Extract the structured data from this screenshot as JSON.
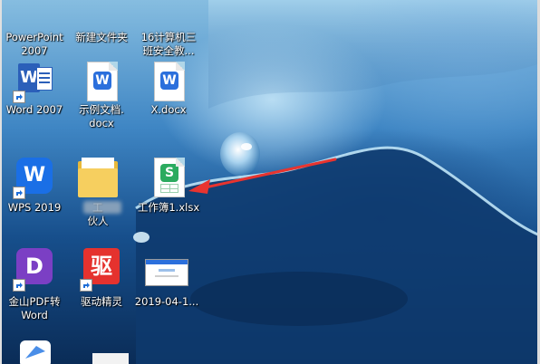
{
  "desktop": {
    "icons": [
      {
        "id": "powerpoint-2007",
        "label_lines": [
          "PowerPoint",
          "2007"
        ]
      },
      {
        "id": "new-folder",
        "label_lines": [
          "新建文件夹"
        ]
      },
      {
        "id": "class-folder",
        "label_lines": [
          "16计算机三",
          "班安全教..."
        ]
      },
      {
        "id": "word-2007",
        "label_lines": [
          "Word 2007"
        ],
        "badge": "W"
      },
      {
        "id": "sample-docx",
        "label_lines": [
          "示例文档.",
          "docx"
        ],
        "badge": "W"
      },
      {
        "id": "x-docx",
        "label_lines": [
          "X.docx"
        ],
        "badge": "W"
      },
      {
        "id": "wps-2019",
        "label_lines": [
          "WPS 2019"
        ],
        "badge": "W"
      },
      {
        "id": "partner-folder",
        "label_lines": [
          "工",
          "伙人"
        ]
      },
      {
        "id": "workbook-xlsx",
        "label_lines": [
          "工作簿1.xlsx"
        ],
        "badge": "S"
      },
      {
        "id": "pdf-converter",
        "label_lines": [
          "金山PDF转",
          "Word"
        ],
        "badge": "D"
      },
      {
        "id": "driver-genius",
        "label_lines": [
          "驱动精灵"
        ],
        "badge": "驱"
      },
      {
        "id": "screenshot-file",
        "label_lines": [
          "2019-04-1..."
        ]
      }
    ]
  },
  "colors": {
    "word_blue": "#2b5fb9",
    "wps_blue": "#1a73e8",
    "excel_green": "#2bab5f",
    "pdf_purple": "#7b3fc4",
    "driver_red": "#e5322e",
    "annotation_arrow": "#e8342f"
  }
}
